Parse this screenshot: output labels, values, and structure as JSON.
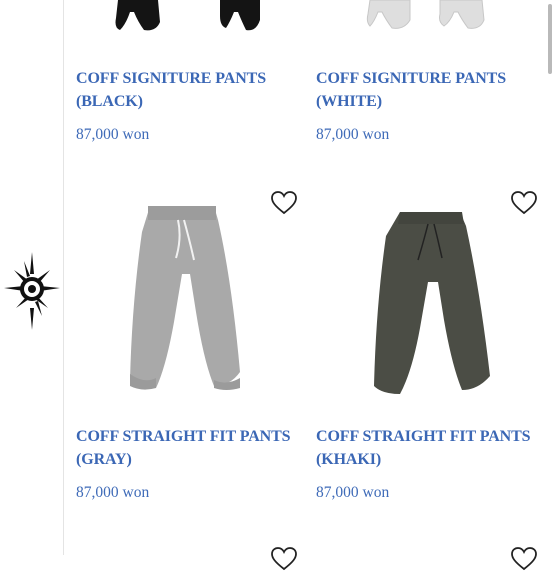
{
  "products": [
    {
      "name": "COFF SIGNITURE PANTS\n(BLACK)",
      "price": "87,000 won",
      "image": "black-sweatpants",
      "color": "#141414"
    },
    {
      "name": "COFF SIGNITURE PANTS\n(WHITE)",
      "price": "87,000 won",
      "image": "white-sweatpants",
      "color": "#dedede"
    },
    {
      "name": "COFF STRAIGHT FIT PANTS\n(GRAY)",
      "price": "87,000 won",
      "image": "gray-sweatpants",
      "color": "#a9a9a9"
    },
    {
      "name": "COFF STRAIGHT FIT PANTS\n(KHAKI)",
      "price": "87,000 won",
      "image": "khaki-sweatpants",
      "color": "#4b4d45"
    }
  ],
  "icons": {
    "wishlist": "heart-outline-icon",
    "brand": "spiky-star-logo-icon"
  },
  "colors": {
    "text_blue": "#3b67b5",
    "background": "#ffffff"
  }
}
